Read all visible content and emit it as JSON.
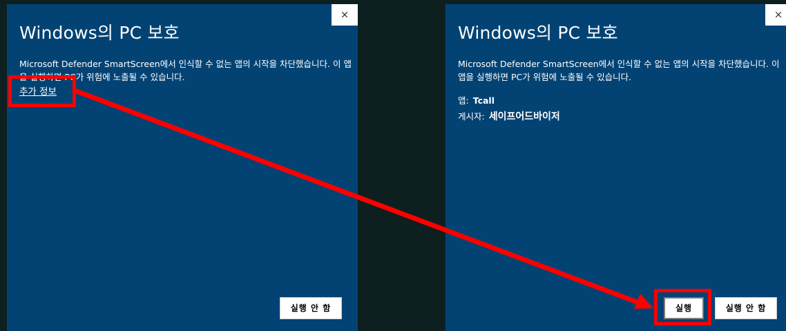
{
  "left_dialog": {
    "close_label": "×",
    "title": "Windows의 PC 보호",
    "description": "Microsoft Defender SmartScreen에서 인식할 수 없는 앱의 시작을 차단했습니다. 이 앱을 실행하면 PC가 위험에 노출될 수 있습니다.",
    "more_info_link": "추가 정보",
    "dont_run_button": "실행 안 함"
  },
  "right_dialog": {
    "close_label": "×",
    "title": "Windows의 PC 보호",
    "description": "Microsoft Defender SmartScreen에서 인식할 수 없는 앱의 시작을 차단했습니다. 이 앱을 실행하면 PC가 위험에 노출될 수 있습니다.",
    "app_label": "앱:",
    "app_value": "Tcall",
    "publisher_label": "게시자:",
    "publisher_value": "세이프어드바이저",
    "run_button": "실행",
    "dont_run_button": "실행 안 함"
  },
  "colors": {
    "dialog_background": "#034374",
    "desktop_background": "#0e1f1f",
    "annotation_red": "#ff0000"
  }
}
